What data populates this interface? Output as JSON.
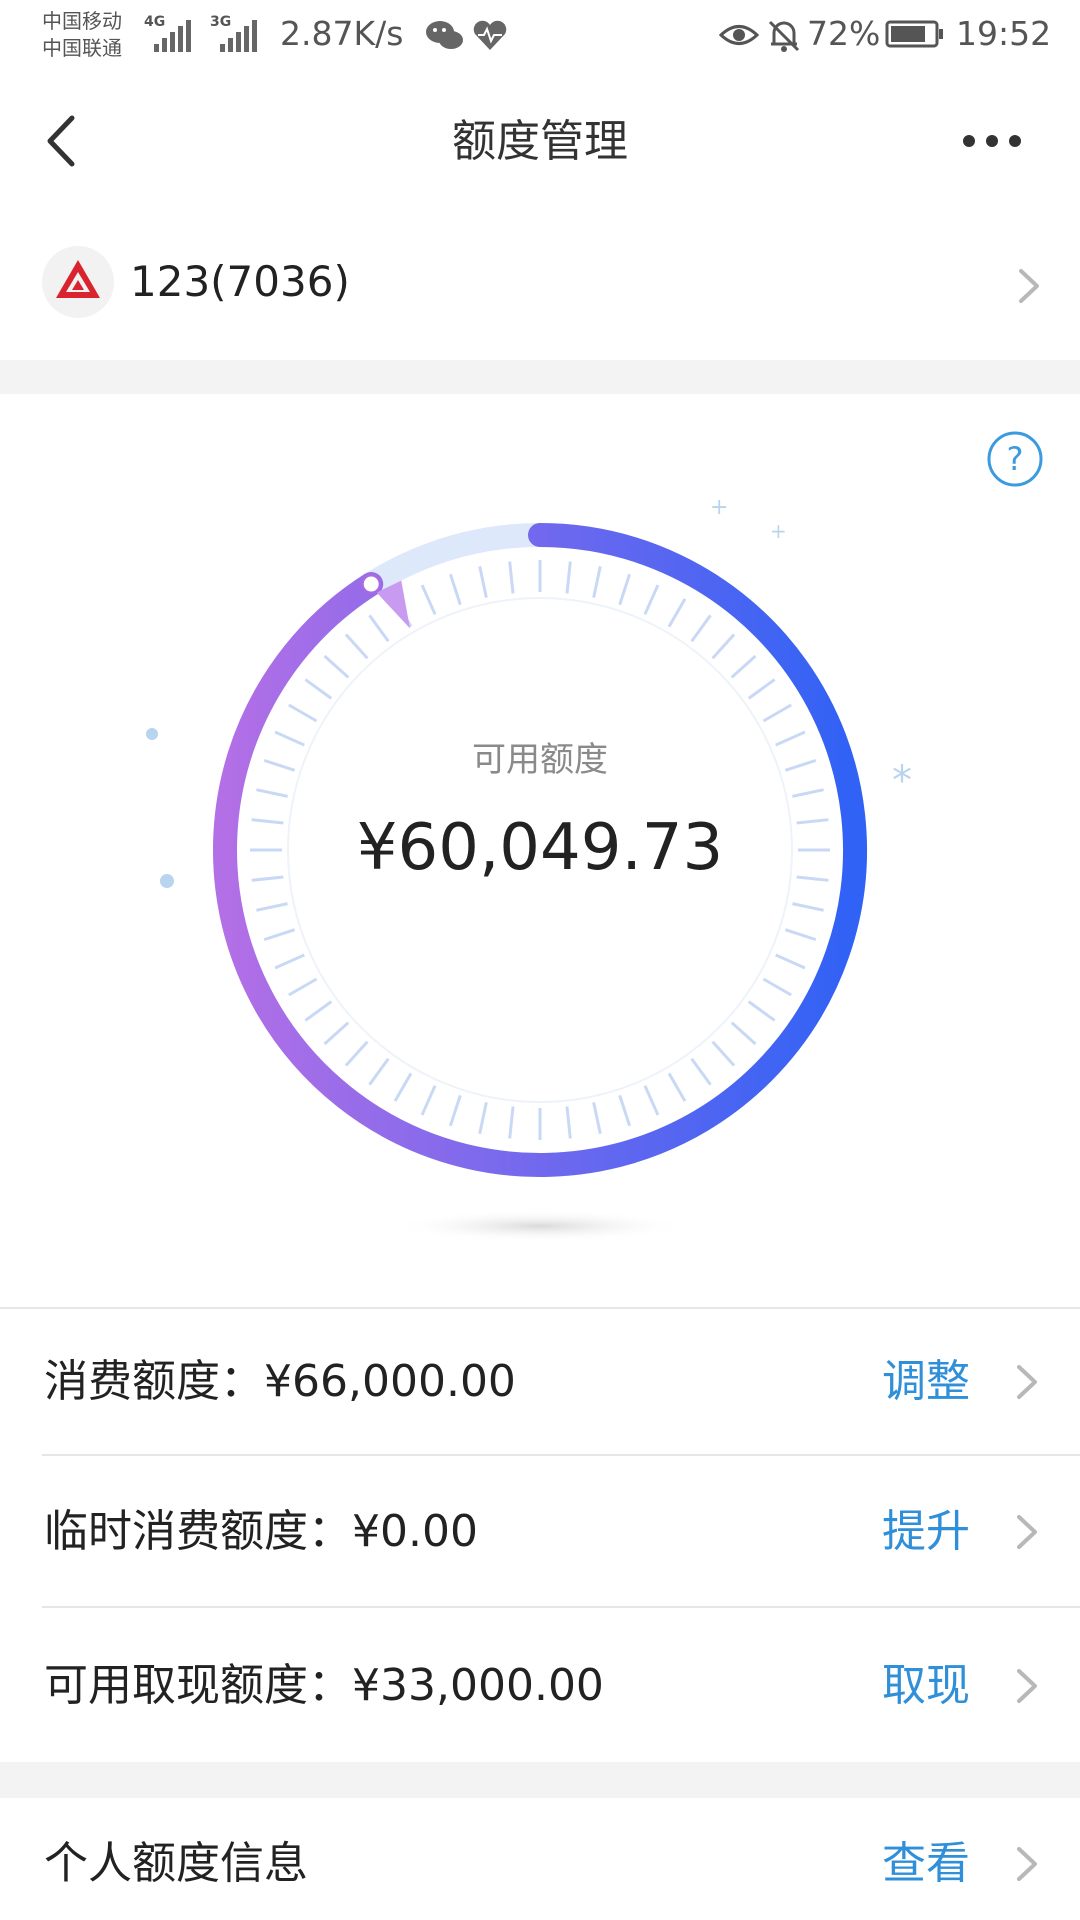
{
  "status_bar": {
    "carrier1": "中国移动",
    "carrier2": "中国联通",
    "net1": "4G",
    "net2": "3G",
    "speed": "2.87K/s",
    "battery_percent": "72%",
    "time": "19:52"
  },
  "nav": {
    "title": "额度管理"
  },
  "card": {
    "label": "123(7036)"
  },
  "gauge": {
    "label": "可用额度",
    "value": "¥60,049.73",
    "fill_fraction": 0.91,
    "colors": {
      "start": "#b36fe6",
      "end": "#2f62f5",
      "track": "#dde8fa",
      "ticks": "#c9d9f5"
    }
  },
  "rows": [
    {
      "label": "消费额度：",
      "value": "¥66,000.00",
      "action": "调整"
    },
    {
      "label": "临时消费额度：",
      "value": "¥0.00",
      "action": "提升"
    },
    {
      "label": "可用取现额度：",
      "value": "¥33,000.00",
      "action": "取现"
    },
    {
      "label": "个人额度信息",
      "value": "",
      "action": "查看"
    }
  ],
  "colors": {
    "accent": "#2f8fd8",
    "bank_red": "#d9232e"
  },
  "icons": [
    "back-icon",
    "more-icon",
    "bank-logo-icon",
    "chevron-right-icon",
    "help-icon",
    "eye-icon",
    "bell-off-icon",
    "battery-icon",
    "wechat-icon",
    "heart-icon"
  ]
}
